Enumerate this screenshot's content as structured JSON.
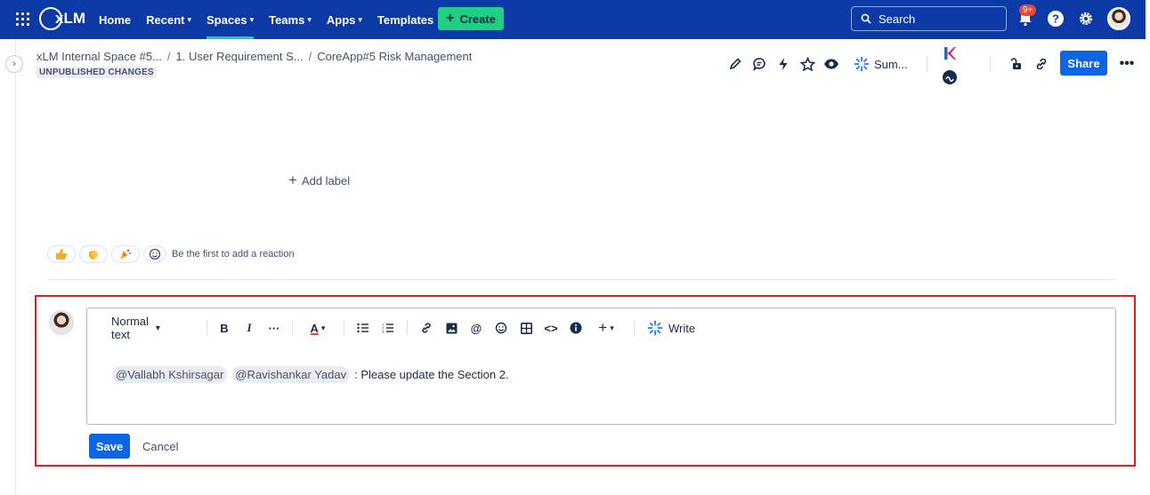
{
  "nav": {
    "logo": "xLM",
    "items": [
      {
        "label": "Home",
        "has_menu": false
      },
      {
        "label": "Recent",
        "has_menu": true
      },
      {
        "label": "Spaces",
        "has_menu": true
      },
      {
        "label": "Teams",
        "has_menu": true
      },
      {
        "label": "Apps",
        "has_menu": true
      },
      {
        "label": "Templates",
        "has_menu": false
      }
    ],
    "active_item": "Spaces",
    "create_label": "Create",
    "search_placeholder": "Search",
    "notifications_badge": "9+",
    "colors": {
      "bar": "#0b3aa6",
      "create": "#1fcf84",
      "active_underline": "#1fcf9a"
    }
  },
  "page": {
    "breadcrumbs": [
      "xLM Internal Space #5...",
      "1. User Requirement S...",
      "CoreApp#5 Risk Management"
    ],
    "status_lozenge": "UNPUBLISHED CHANGES",
    "summarize_label": "Sum...",
    "share_label": "Share",
    "add_label": "Add label",
    "reaction_prompt": "Be the first to add a reaction"
  },
  "comment_editor": {
    "text_style": "Normal text",
    "write_label": "Write",
    "mentions": [
      "@Vallabh Kshirsagar",
      "@Ravishankar Yadav"
    ],
    "message": ": Please update the Section 2.",
    "save_label": "Save",
    "cancel_label": "Cancel",
    "highlight_color": "#e01e25"
  }
}
